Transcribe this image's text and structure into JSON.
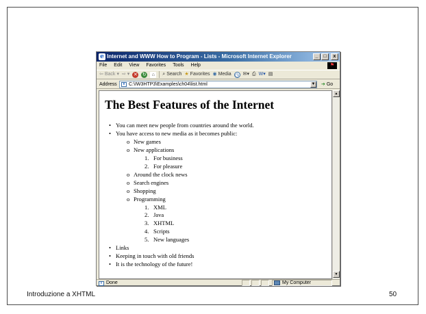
{
  "slide": {
    "footer_title": "Introduzione a XHTML",
    "page_number": "50"
  },
  "window": {
    "title": "Internet and WWW How to Program - Lists - Microsoft Internet Explorer",
    "controls": [
      "_",
      "□",
      "x"
    ]
  },
  "menu": [
    "File",
    "Edit",
    "View",
    "Favorites",
    "Tools",
    "Help"
  ],
  "toolbar": {
    "back": "Back",
    "search": "Search",
    "favorites": "Favorites",
    "media": "Media"
  },
  "address": {
    "label": "Address",
    "value": "C:\\IW3HTP3\\Examples\\ch04\\list.html",
    "go": "Go"
  },
  "page": {
    "heading": "The Best Features of the Internet",
    "items": [
      {
        "level": 0,
        "marker": "•",
        "text": "You can meet new people from countries around the world."
      },
      {
        "level": 0,
        "marker": "•",
        "text": "You have access to new media as it becomes public:"
      },
      {
        "level": 1,
        "marker": "o",
        "text": "New games"
      },
      {
        "level": 1,
        "marker": "o",
        "text": "New applications"
      },
      {
        "level": 2,
        "marker": "1.",
        "text": "For business"
      },
      {
        "level": 2,
        "marker": "2.",
        "text": "For pleasure"
      },
      {
        "level": 1,
        "marker": "o",
        "text": "Around the clock news"
      },
      {
        "level": 1,
        "marker": "o",
        "text": "Search engines"
      },
      {
        "level": 1,
        "marker": "o",
        "text": "Shopping"
      },
      {
        "level": 1,
        "marker": "o",
        "text": "Programming"
      },
      {
        "level": 2,
        "marker": "1.",
        "text": "XML"
      },
      {
        "level": 2,
        "marker": "2.",
        "text": "Java"
      },
      {
        "level": 2,
        "marker": "3.",
        "text": "XHTML"
      },
      {
        "level": 2,
        "marker": "4.",
        "text": "Scripts"
      },
      {
        "level": 2,
        "marker": "5.",
        "text": "New languages"
      },
      {
        "level": 0,
        "marker": "•",
        "text": "Links"
      },
      {
        "level": 0,
        "marker": "•",
        "text": "Keeping in touch with old friends"
      },
      {
        "level": 0,
        "marker": "•",
        "text": "It is the technology of the future!"
      }
    ]
  },
  "status": {
    "text": "Done",
    "zone": "My Computer"
  }
}
